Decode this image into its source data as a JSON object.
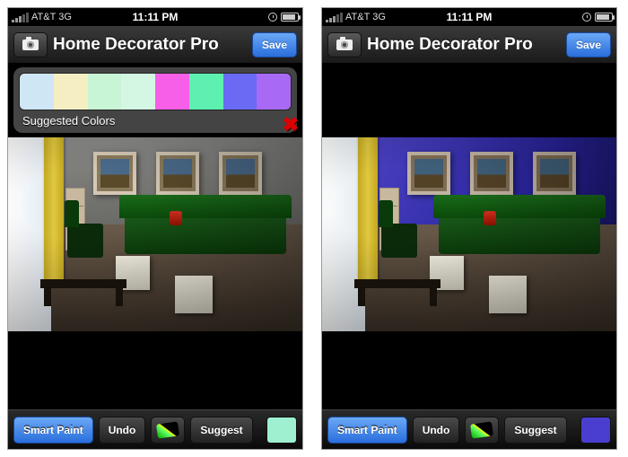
{
  "status": {
    "carrier": "AT&T",
    "network": "3G",
    "time": "11:11 PM"
  },
  "nav": {
    "title": "Home Decorator Pro",
    "save_label": "Save"
  },
  "panel": {
    "label": "Suggested Colors",
    "swatches": [
      "#cfe6f5",
      "#f5eec2",
      "#c8f5d6",
      "#d4f7e4",
      "#f75fe8",
      "#5ef0b0",
      "#6a6af5",
      "#a86af5"
    ]
  },
  "toolbar": {
    "smart_paint": "Smart Paint",
    "undo": "Undo",
    "suggest": "Suggest",
    "preview_left": "#9ef0d0",
    "preview_right": "#4a3ed0"
  }
}
